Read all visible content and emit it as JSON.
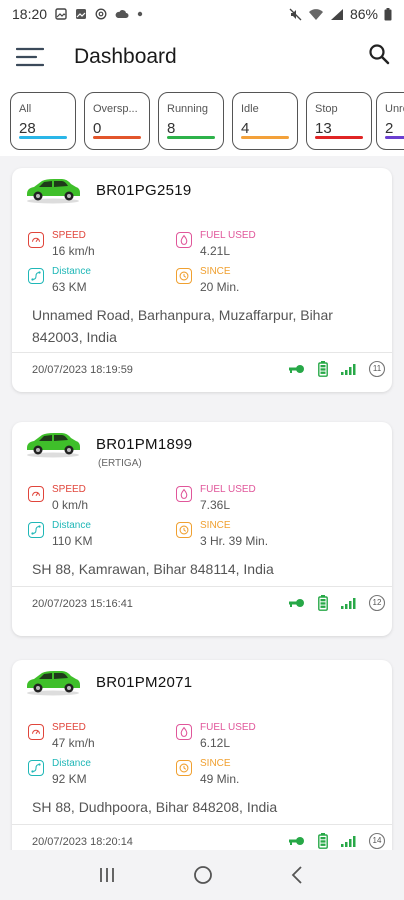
{
  "status_bar": {
    "time": "18:20",
    "battery": "86%"
  },
  "app_bar": {
    "title": "Dashboard"
  },
  "filters": [
    {
      "label": "All",
      "count": "28",
      "color": "#2ab6e8"
    },
    {
      "label": "Oversp...",
      "count": "0",
      "color": "#e2552b"
    },
    {
      "label": "Running",
      "count": "8",
      "color": "#2db24a"
    },
    {
      "label": "Idle",
      "count": "4",
      "color": "#f3a13a"
    },
    {
      "label": "Stop",
      "count": "13",
      "color": "#e02424"
    },
    {
      "label": "Unre...",
      "count": "2",
      "color": "#6b3fd1"
    }
  ],
  "labels": {
    "speed": "SPEED",
    "fuel": "FUEL USED",
    "distance": "Distance",
    "since": "SINCE"
  },
  "colors": {
    "speed": "#e0453b",
    "fuel": "#e0569a",
    "distance": "#1fb7b7",
    "since": "#f0a030",
    "car": "#3fbf2a",
    "signal": "#27a847"
  },
  "vehicles": [
    {
      "plate": "BR01PG2519",
      "model": "",
      "speed": "16 km/h",
      "fuel": "4.21L",
      "distance": "63 KM",
      "since": "20 Min.",
      "address": "Unnamed Road, Barhanpura, Muzaffarpur, Bihar 842003, India",
      "timestamp": "20/07/2023 18:19:59",
      "satellites": "11"
    },
    {
      "plate": "BR01PM1899",
      "model": "(ERTIGA)",
      "speed": "0 km/h",
      "fuel": "7.36L",
      "distance": "110 KM",
      "since": "3 Hr. 39 Min.",
      "address": "SH 88, Kamrawan, Bihar 848114, India",
      "timestamp": "20/07/2023 15:16:41",
      "satellites": "12"
    },
    {
      "plate": "BR01PM2071",
      "model": "",
      "speed": "47 km/h",
      "fuel": "6.12L",
      "distance": "92 KM",
      "since": "49 Min.",
      "address": "SH 88, Dudhpoora, Bihar 848208, India",
      "timestamp": "20/07/2023 18:20:14",
      "satellites": "14"
    }
  ]
}
